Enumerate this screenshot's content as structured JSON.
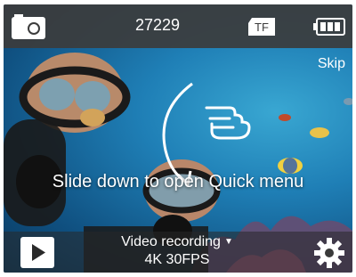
{
  "status": {
    "photo_count": "27229",
    "storage_icon": "tf-card-icon",
    "storage_label": "TF",
    "battery_icon": "battery-full-icon",
    "photo_icon": "photo-mode-icon"
  },
  "overlay": {
    "skip_label": "Skip",
    "hint": "Slide down to open Quick menu",
    "gesture_icon": "swipe-down-hand-icon"
  },
  "bottom": {
    "playback_icon": "play-icon",
    "mode_line1": "Video recording",
    "mode_line2": "4K 30FPS",
    "settings_icon": "gear-icon"
  },
  "colors": {
    "water": "#1f7fb6",
    "topbar": "#3c3c3c",
    "text": "#ffffff"
  }
}
